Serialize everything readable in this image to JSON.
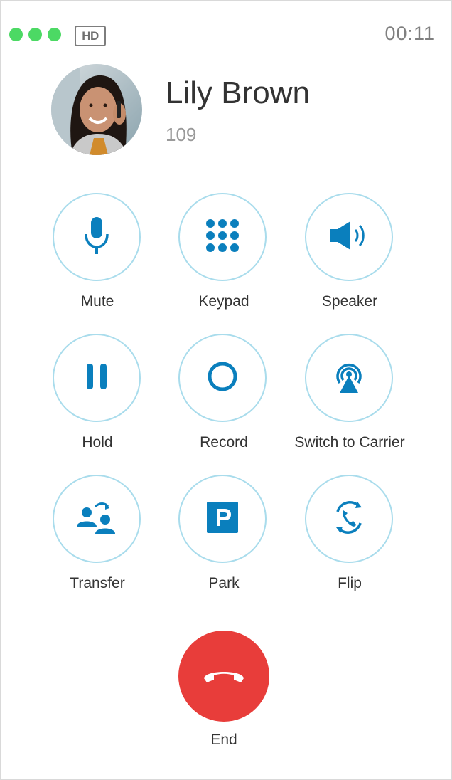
{
  "header": {
    "hd_badge": "HD",
    "timer": "00:11",
    "window_dot_colors": [
      "#4cd964",
      "#4cd964",
      "#4cd964"
    ]
  },
  "contact": {
    "name": "Lily Brown",
    "extension": "109"
  },
  "actions": {
    "mute": "Mute",
    "keypad": "Keypad",
    "speaker": "Speaker",
    "hold": "Hold",
    "record": "Record",
    "switch_to_carrier": "Switch to Carrier",
    "transfer": "Transfer",
    "park": "Park",
    "flip": "Flip",
    "end": "End"
  },
  "colors": {
    "accent": "#0a7fbd",
    "button_border": "#a9dcec",
    "end_red": "#e83d3a"
  }
}
